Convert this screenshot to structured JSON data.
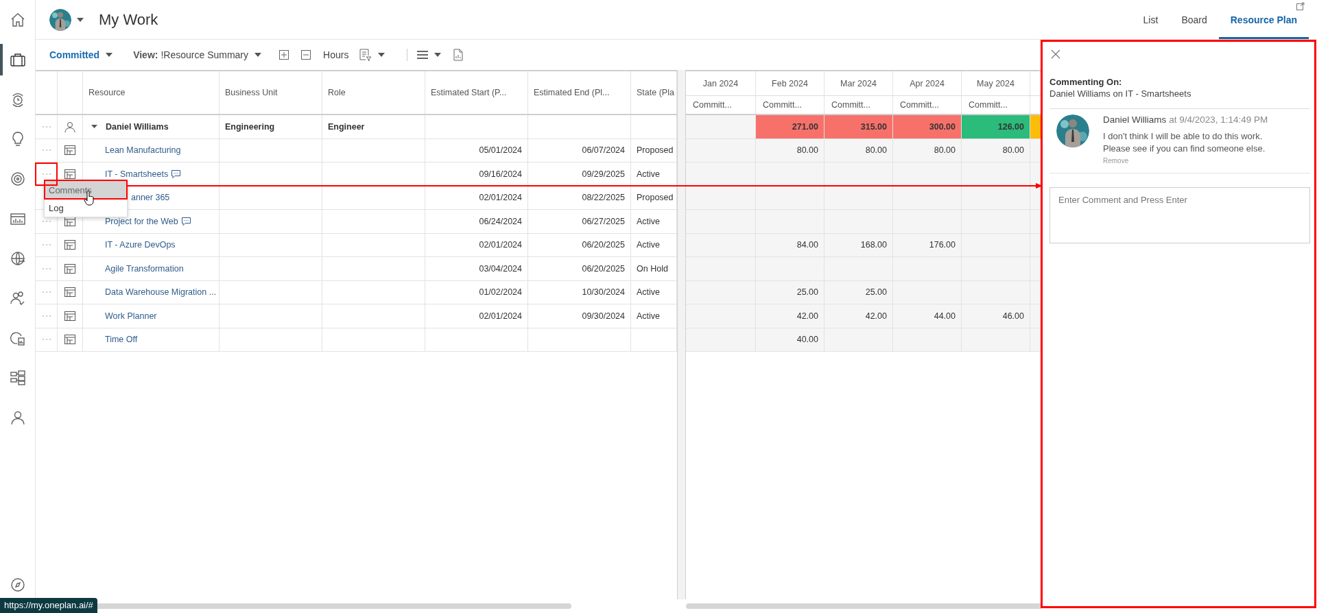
{
  "rail": [
    {
      "selected": false
    },
    {
      "selected": true
    },
    {
      "selected": false
    },
    {
      "selected": false
    },
    {
      "selected": false
    },
    {
      "selected": false
    },
    {
      "selected": false
    },
    {
      "selected": false
    },
    {
      "selected": false
    },
    {
      "selected": false
    },
    {
      "selected": false
    }
  ],
  "header": {
    "title": "My Work",
    "view_tabs": [
      {
        "label": "List",
        "selected": false
      },
      {
        "label": "Board",
        "selected": false
      },
      {
        "label": "Resource Plan",
        "selected": true
      }
    ]
  },
  "toolbar": {
    "measure": "Committed",
    "view_label": "View:",
    "view": "!Resource Summary",
    "units": "Hours"
  },
  "table": {
    "columns": [
      "Resource",
      "Business Unit",
      "Role",
      "Estimated Start (P...",
      "Estimated End (Pl...",
      "State (Pla"
    ],
    "rows": [
      {
        "kind": "resource",
        "name": "Daniel Williams",
        "expanded": true,
        "business_unit": "Engineering",
        "role": "Engineer",
        "cells": [
          {
            "kind": "blank"
          },
          {
            "kind": "total",
            "value": "271.00",
            "color": "#f7716a"
          },
          {
            "kind": "total",
            "value": "315.00",
            "color": "#f7716a"
          },
          {
            "kind": "total",
            "value": "300.00",
            "color": "#f7716a"
          },
          {
            "kind": "total",
            "value": "126.00",
            "color": "#2bbb7b"
          },
          {
            "kind": "total",
            "color": "#fbbc0a"
          }
        ]
      },
      {
        "kind": "project",
        "name": "Lean Manufacturing",
        "start": "05/01/2024",
        "end": "06/07/2024",
        "state": "Proposed",
        "cells": [
          {
            "kind": "blank"
          },
          {
            "kind": "hours",
            "value": "80.00"
          },
          {
            "kind": "hours",
            "value": "80.00"
          },
          {
            "kind": "hours",
            "value": "80.00"
          },
          {
            "kind": "hours",
            "value": "80.00"
          }
        ]
      },
      {
        "kind": "project",
        "name": "IT - Smartsheets",
        "comment": true,
        "start": "09/16/2024",
        "end": "09/29/2025",
        "state": "Active"
      },
      {
        "kind": "project",
        "name": "anner 365",
        "partly_covered": true,
        "start": "02/01/2024",
        "end": "08/22/2025",
        "state": "Proposed"
      },
      {
        "kind": "project",
        "name": "Project for the Web",
        "comment": true,
        "start": "06/24/2024",
        "end": "06/27/2025",
        "state": "Active"
      },
      {
        "kind": "project",
        "name": "IT - Azure DevOps",
        "start": "02/01/2024",
        "end": "06/20/2025",
        "state": "Active",
        "cells": [
          {
            "kind": "blank"
          },
          {
            "kind": "hours",
            "value": "84.00"
          },
          {
            "kind": "hours",
            "value": "168.00"
          },
          {
            "kind": "hours",
            "value": "176.00"
          }
        ]
      },
      {
        "kind": "project",
        "name": "Agile Transformation",
        "start": "03/04/2024",
        "end": "06/20/2025",
        "state": "On Hold"
      },
      {
        "kind": "project",
        "name": "Data Warehouse Migration ...",
        "start": "01/02/2024",
        "end": "10/30/2024",
        "state": "Active",
        "cells": [
          {
            "kind": "blank"
          },
          {
            "kind": "hours",
            "value": "25.00"
          },
          {
            "kind": "hours",
            "value": "25.00"
          }
        ]
      },
      {
        "kind": "project",
        "name": "Work Planner",
        "start": "02/01/2024",
        "end": "09/30/2024",
        "state": "Active",
        "cells": [
          {
            "kind": "blank"
          },
          {
            "kind": "hours",
            "value": "42.00"
          },
          {
            "kind": "hours",
            "value": "42.00"
          },
          {
            "kind": "hours",
            "value": "44.00"
          },
          {
            "kind": "hours",
            "value": "46.00"
          }
        ]
      },
      {
        "kind": "project",
        "name": "Time Off",
        "cells": [
          {
            "kind": "blank"
          },
          {
            "kind": "hours",
            "value": "40.00"
          }
        ]
      }
    ]
  },
  "timeline": {
    "months": [
      {
        "label": "Jan 2024",
        "measure": "Committ..."
      },
      {
        "label": "Feb 2024",
        "measure": "Committ..."
      },
      {
        "label": "Mar 2024",
        "measure": "Committ..."
      },
      {
        "label": "Apr 2024",
        "measure": "Committ..."
      },
      {
        "label": "May 2024",
        "measure": "Committ..."
      }
    ]
  },
  "context_menu": {
    "items": [
      {
        "label": "Comments",
        "selected": true
      },
      {
        "label": "Log",
        "selected": false
      }
    ]
  },
  "comment_panel": {
    "heading": "Commenting On:",
    "subject": "Daniel Williams on IT - Smartsheets",
    "comments": [
      {
        "author": "Daniel Williams",
        "timestamp": "at 9/4/2023, 1:14:49 PM",
        "text": "I don't think I will be able to do this work.\nPlease see if you can find someone else.",
        "remove": "Remove"
      }
    ],
    "input": {
      "placeholder": "Enter Comment and Press Enter"
    }
  },
  "status_url": "https://my.oneplan.ai/#"
}
